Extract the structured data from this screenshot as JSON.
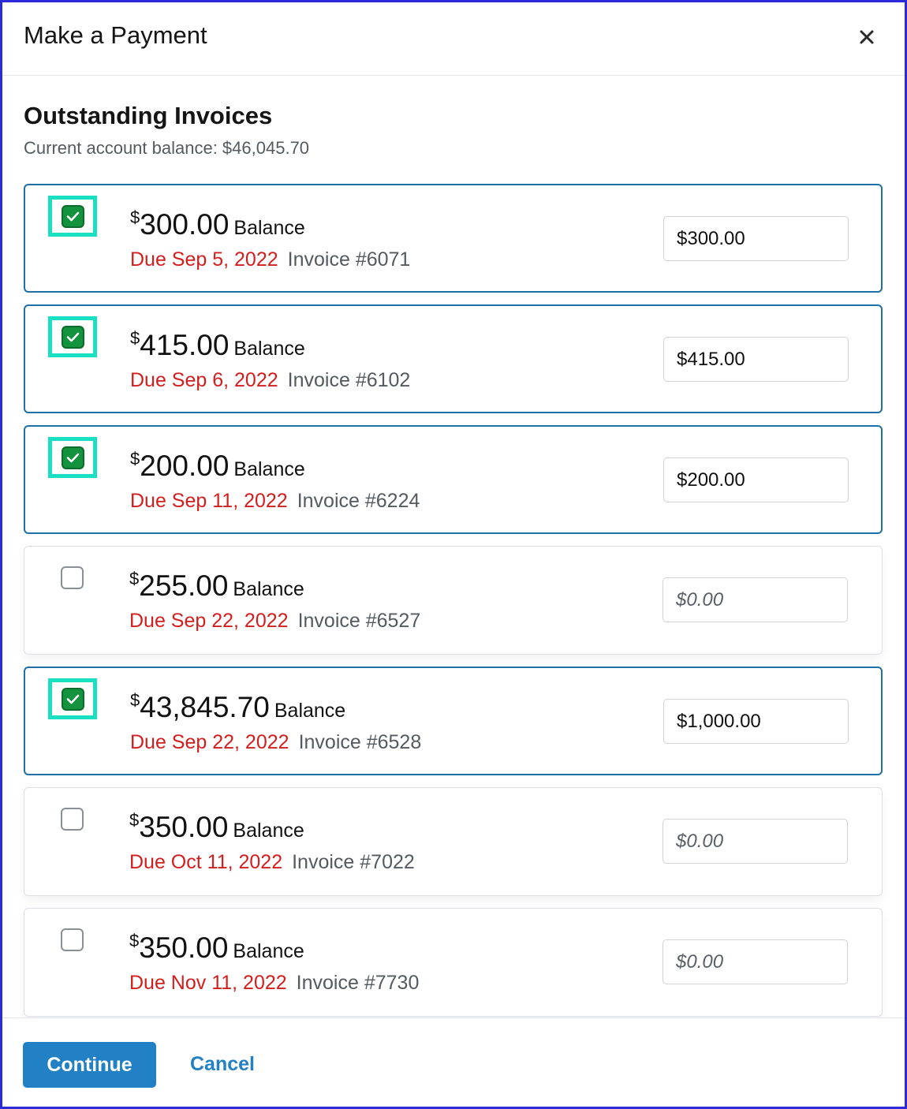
{
  "header": {
    "title": "Make a Payment",
    "close_label": "×"
  },
  "section": {
    "title": "Outstanding Invoices",
    "balance_text": "Current account balance: $46,045.70"
  },
  "invoices": [
    {
      "currency": "$",
      "amount": "300.00",
      "balance_label": "Balance",
      "due": "Due Sep 5, 2022",
      "invoice": "Invoice #6071",
      "selected": true,
      "payment_value": "$300.00",
      "payment_placeholder": "$0.00"
    },
    {
      "currency": "$",
      "amount": "415.00",
      "balance_label": "Balance",
      "due": "Due Sep 6, 2022",
      "invoice": "Invoice #6102",
      "selected": true,
      "payment_value": "$415.00",
      "payment_placeholder": "$0.00"
    },
    {
      "currency": "$",
      "amount": "200.00",
      "balance_label": "Balance",
      "due": "Due Sep 11, 2022",
      "invoice": "Invoice #6224",
      "selected": true,
      "payment_value": "$200.00",
      "payment_placeholder": "$0.00"
    },
    {
      "currency": "$",
      "amount": "255.00",
      "balance_label": "Balance",
      "due": "Due Sep 22, 2022",
      "invoice": "Invoice #6527",
      "selected": false,
      "payment_value": "",
      "payment_placeholder": "$0.00"
    },
    {
      "currency": "$",
      "amount": "43,845.70",
      "balance_label": "Balance",
      "due": "Due Sep 22, 2022",
      "invoice": "Invoice #6528",
      "selected": true,
      "payment_value": "$1,000.00",
      "payment_placeholder": "$0.00"
    },
    {
      "currency": "$",
      "amount": "350.00",
      "balance_label": "Balance",
      "due": "Due Oct 11, 2022",
      "invoice": "Invoice #7022",
      "selected": false,
      "payment_value": "",
      "payment_placeholder": "$0.00"
    },
    {
      "currency": "$",
      "amount": "350.00",
      "balance_label": "Balance",
      "due": "Due Nov 11, 2022",
      "invoice": "Invoice #7730",
      "selected": false,
      "payment_value": "",
      "payment_placeholder": "$0.00"
    }
  ],
  "footer": {
    "continue_label": "Continue",
    "cancel_label": "Cancel"
  },
  "colors": {
    "accent": "#2281c4",
    "selected_border": "#1f6fa8",
    "checkbox_checked": "#13933e",
    "focus_ring": "#19e0c2",
    "due_text": "#d31e1e"
  },
  "icons": {
    "close": "close-icon",
    "check": "checkmark-icon"
  }
}
